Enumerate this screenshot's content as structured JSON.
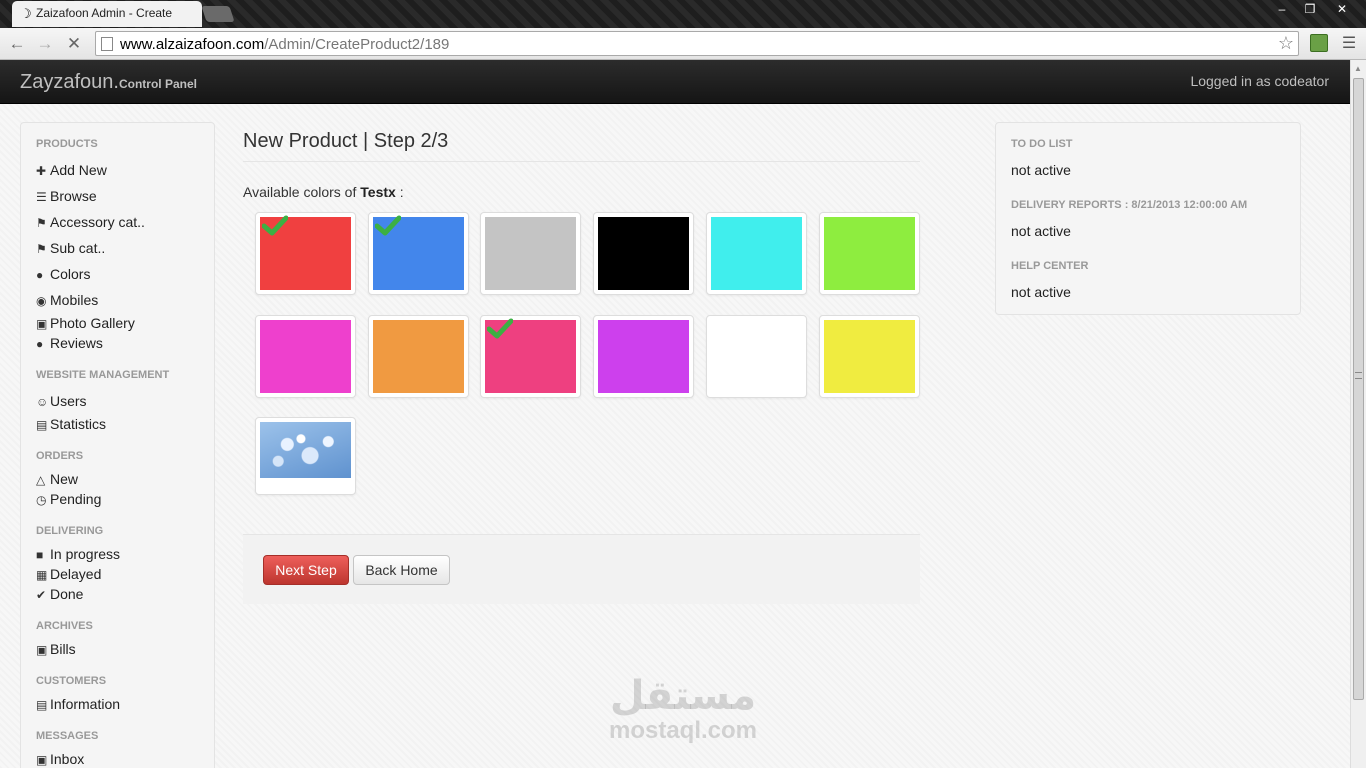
{
  "browser": {
    "tab_title": "Zaizafoon Admin - Create",
    "url_host": "www.alzaizafoon.com",
    "url_path": "/Admin/CreateProduct2/189",
    "window_controls": [
      "‒",
      "❐",
      "✕"
    ]
  },
  "navbar": {
    "brand": "Zayzafoun.",
    "brand_sub": "Control Panel",
    "logged_in": "Logged in as codeator"
  },
  "sidebar": {
    "sections": [
      {
        "header": "PRODUCTS",
        "items": [
          {
            "label": "Add New",
            "icon": "plus-icon"
          },
          {
            "label": "Browse",
            "icon": "list-icon"
          },
          {
            "label": "Accessory cat..",
            "icon": "tag-icon"
          },
          {
            "label": "Sub cat..",
            "icon": "tag-icon"
          },
          {
            "label": "Colors",
            "icon": "drop-icon"
          },
          {
            "label": "Mobiles",
            "icon": "globe-icon"
          },
          {
            "label": "Photo Gallery",
            "icon": "picture-icon"
          },
          {
            "label": "Reviews",
            "icon": "comment-icon"
          }
        ]
      },
      {
        "header": "WEBSITE MANAGEMENT",
        "items": [
          {
            "label": "Users",
            "icon": "smile-icon"
          },
          {
            "label": "Statistics",
            "icon": "chart-icon"
          }
        ]
      },
      {
        "header": "ORDERS",
        "items": [
          {
            "label": "New",
            "icon": "bell-icon"
          },
          {
            "label": "Pending",
            "icon": "clock-icon"
          }
        ]
      },
      {
        "header": "DELIVERING",
        "items": [
          {
            "label": "In progress",
            "icon": "truck-icon"
          },
          {
            "label": "Delayed",
            "icon": "calendar-icon"
          },
          {
            "label": "Done",
            "icon": "check-circle-icon"
          }
        ]
      },
      {
        "header": "ARCHIVES",
        "items": [
          {
            "label": "Bills",
            "icon": "archive-icon"
          }
        ]
      },
      {
        "header": "CUSTOMERS",
        "items": [
          {
            "label": "Information",
            "icon": "book-icon"
          }
        ]
      },
      {
        "header": "MESSAGES",
        "items": [
          {
            "label": "Inbox",
            "icon": "inbox-icon"
          }
        ]
      }
    ]
  },
  "main": {
    "title": "New Product | Step 2/3",
    "available_prefix": "Available colors of",
    "product_name": "Testx",
    "available_suffix": ":",
    "colors": [
      {
        "hex": "#f04040",
        "selected": true
      },
      {
        "hex": "#4386eb",
        "selected": true
      },
      {
        "hex": "#c4c4c4",
        "selected": false
      },
      {
        "hex": "#000000",
        "selected": false
      },
      {
        "hex": "#40eeed",
        "selected": false
      },
      {
        "hex": "#8eed3f",
        "selected": false
      },
      {
        "hex": "#ee40cd",
        "selected": false
      },
      {
        "hex": "#f09a41",
        "selected": false
      },
      {
        "hex": "#ee4080",
        "selected": true
      },
      {
        "hex": "#cd40ed",
        "selected": false
      },
      {
        "hex": "#ffffff",
        "selected": false
      },
      {
        "hex": "#f0ec40",
        "selected": false
      }
    ],
    "extra_swatch": "water-bubbles-image",
    "next_button": "Next Step",
    "back_button": "Back Home"
  },
  "right_panel": {
    "todo_header": "TO DO LIST",
    "todo_value": "not active",
    "delivery_header": "DELIVERY REPORTS : 8/21/2013 12:00:00 AM",
    "delivery_value": "not active",
    "help_header": "HELP CENTER",
    "help_value": "not active"
  },
  "watermark": {
    "logo_text": "مستقل",
    "text": "mostaql.com"
  },
  "theme": {
    "check_color": "#3cb043",
    "danger": "#da4f49"
  }
}
